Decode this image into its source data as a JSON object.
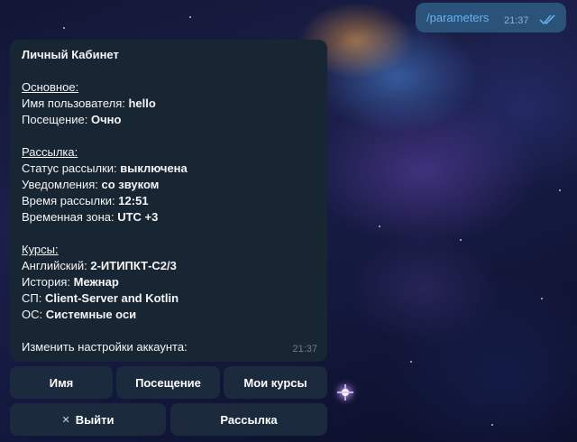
{
  "outgoing": {
    "text": "/parameters",
    "time": "21:37",
    "status_icon": "double-check-icon"
  },
  "incoming": {
    "title": "Личный Кабинет",
    "sections": {
      "basic": {
        "header": "Основное:",
        "rows": [
          {
            "label": "Имя пользователя: ",
            "value": "hello"
          },
          {
            "label": "Посещение: ",
            "value": "Очно"
          }
        ]
      },
      "mailing": {
        "header": "Рассылка:",
        "rows": [
          {
            "label": "Статус рассылки: ",
            "value": "выключена"
          },
          {
            "label": "Уведомления: ",
            "value": "со звуком"
          },
          {
            "label": "Время рассылки: ",
            "value": "12:51"
          },
          {
            "label": "Временная зона: ",
            "value": "UTC +3"
          }
        ]
      },
      "courses": {
        "header": "Курсы:",
        "rows": [
          {
            "label": "Английский: ",
            "value": "2-ИТИПКТ-С2/3"
          },
          {
            "label": "История: ",
            "value": "Межнар"
          },
          {
            "label": "СП: ",
            "value": "Client-Server and Kotlin"
          },
          {
            "label": "ОС: ",
            "value": "Системные оси"
          }
        ]
      }
    },
    "footer": "Изменить настройки аккаунта:",
    "time": "21:37"
  },
  "keyboard": {
    "name": "Имя",
    "attendance": "Посещение",
    "my_courses": "Мои курсы",
    "logout": "Выйти",
    "logout_icon": "close-icon",
    "mailing": "Рассылка"
  },
  "colors": {
    "outgoing_bubble": "#2b5278",
    "incoming_bubble": "#182533",
    "link_text": "#6ab3f3",
    "check_marks": "#5fb2e6"
  }
}
